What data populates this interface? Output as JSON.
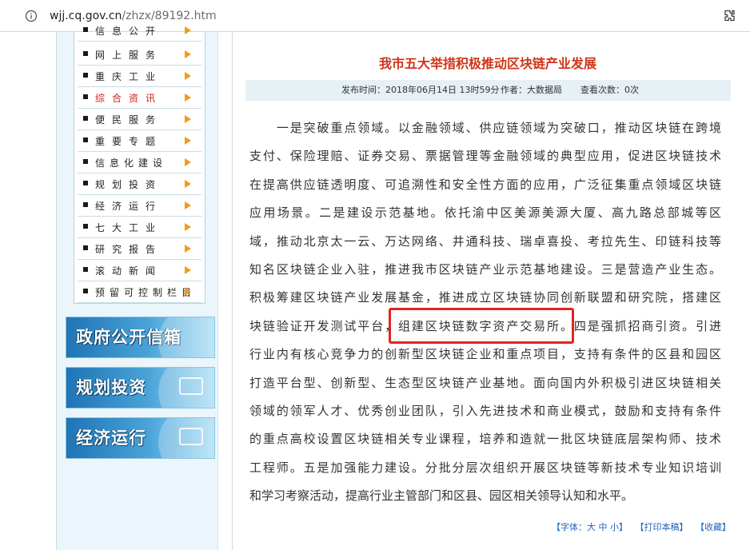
{
  "browser": {
    "url_domain": "wjj.cq.gov.cn",
    "url_path": "/zhzx/89192.htm",
    "info_icon": "info-icon",
    "extension_icon": "puzzle-icon"
  },
  "sidebar": {
    "nav_items": [
      {
        "label": "信息公开",
        "active": false
      },
      {
        "label": "网上服务",
        "active": false
      },
      {
        "label": "重庆工业",
        "active": false
      },
      {
        "label": "综合资讯",
        "active": true
      },
      {
        "label": "便民服务",
        "active": false
      },
      {
        "label": "重要专题",
        "active": false
      },
      {
        "label": "信息化建设",
        "active": false
      },
      {
        "label": "规划投资",
        "active": false
      },
      {
        "label": "经济运行",
        "active": false
      },
      {
        "label": "七大工业",
        "active": false
      },
      {
        "label": "研究报告",
        "active": false
      },
      {
        "label": "滚动新闻",
        "active": false
      },
      {
        "label": "预留可控制栏目",
        "active": false
      }
    ],
    "banners": [
      {
        "label": "政府公开信箱"
      },
      {
        "label": "规划投资"
      },
      {
        "label": "经济运行"
      }
    ]
  },
  "article": {
    "title": "我市五大举措积极推动区块链产业发展",
    "publish_time": "发布时间：2018年06月14日 13时59分",
    "author": "作者：大数据局",
    "views": "查看次数：0次",
    "lines": [
      "　　一是突破重点领域。以金融领域、供应链领域为突破口，推动区块链在跨境",
      "支付、保险理赔、证券交易、票据管理等金融领域的典型应用，促进区块链技术",
      "在提高供应链透明度、可追溯性和安全性方面的应用，广泛征集重点领域区块链",
      "应用场景。二是建设示范基地。依托渝中区美源美源大厦、高九路总部城等区",
      "域，推动北京太一云、万达网络、井通科技、瑞卓喜投、考拉先生、印链科技等",
      "知名区块链企业入驻，推进我市区块链产业示范基地建设。三是营造产业生态。",
      "积极筹建区块链产业发展基金，推进成立区块链协同创新联盟和研究院，搭建区",
      "块链验证开发测试平台，组建区块链数字资产交易所。四是强抓招商引资。引进",
      "行业内有核心竞争力的创新型区块链企业和重点项目，支持有条件的区县和园区",
      "打造平台型、创新型、生态型区块链产业基地。面向国内外积极引进区块链相关",
      "领域的领军人才、优秀创业团队，引入先进技术和商业模式，鼓励和支持有条件",
      "的重点高校设置区块链相关专业课程，培养和造就一批区块链底层架构师、技术",
      "工程师。五是加强能力建设。分批分层次组织开展区块链等新技术专业知识培训",
      "和学习考察活动，提高行业主管部门和区县、园区相关领导认知和水平。"
    ],
    "highlighted_phrase": "组建区块链数字资产交易所"
  },
  "footer": {
    "font_size": "【字体：大 中 小】",
    "print": "【打印本稿】",
    "favorite": "【收藏】"
  },
  "colors": {
    "title": "#d0351b",
    "highlight_border": "#e0251f",
    "link": "#1f63b8",
    "nav_arrow": "#f19b1d"
  }
}
